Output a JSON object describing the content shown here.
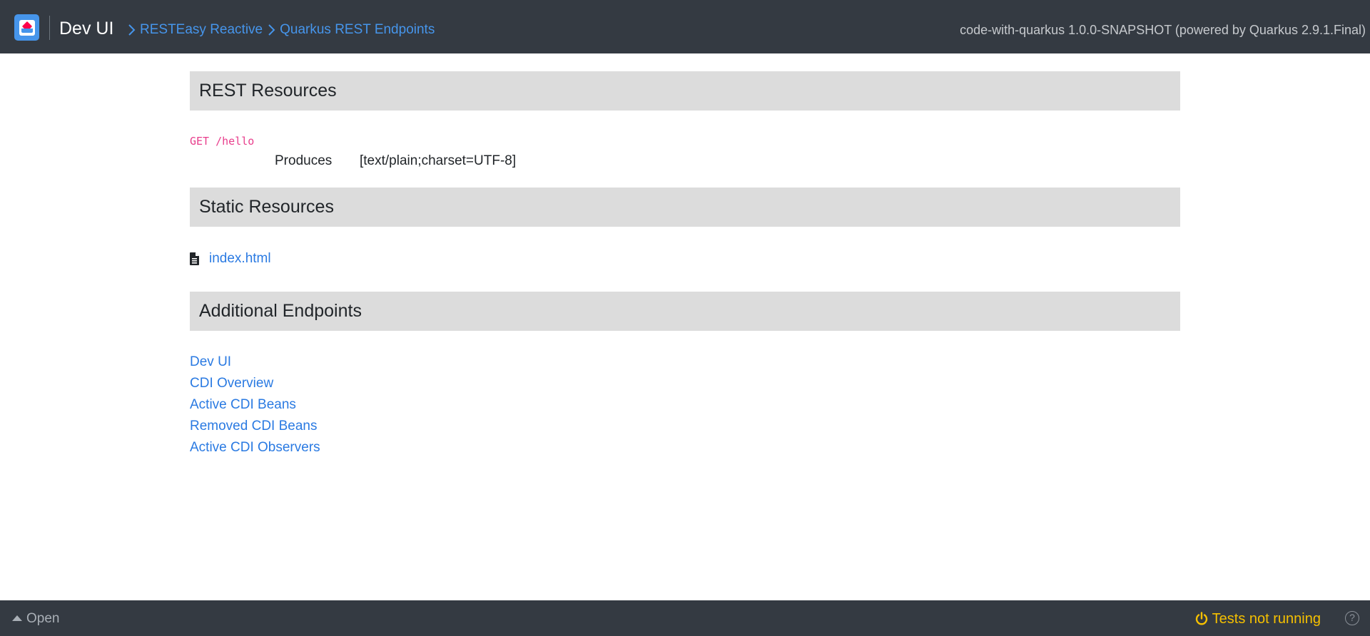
{
  "header": {
    "logo_icon": "quarkus-logo-icon",
    "app_title": "Dev UI",
    "breadcrumb": [
      {
        "label": "RESTEasy Reactive"
      },
      {
        "label": "Quarkus REST Endpoints"
      }
    ],
    "version": "code-with-quarkus 1.0.0-SNAPSHOT (powered by Quarkus 2.9.1.Final)"
  },
  "rest_resources": {
    "title": "REST Resources",
    "endpoint": "GET /hello",
    "produces_label": "Produces",
    "produces_value": "[text/plain;charset=UTF-8]"
  },
  "static_resources": {
    "title": "Static Resources",
    "files": [
      {
        "name": "index.html",
        "icon": "file-text-icon"
      }
    ]
  },
  "additional_endpoints": {
    "title": "Additional Endpoints",
    "links": [
      {
        "label": "Dev UI"
      },
      {
        "label": "CDI Overview"
      },
      {
        "label": "Active CDI Beans"
      },
      {
        "label": "Removed CDI Beans"
      },
      {
        "label": "Active CDI Observers"
      }
    ]
  },
  "footer": {
    "open_label": "Open",
    "tests_status": "Tests not running",
    "help_symbol": "?"
  },
  "colors": {
    "bar_background": "#343a42",
    "link": "#2a7ae2",
    "section_header": "#dcdcdc",
    "code": "#e83e8c",
    "tests_warning": "#f5c000"
  }
}
